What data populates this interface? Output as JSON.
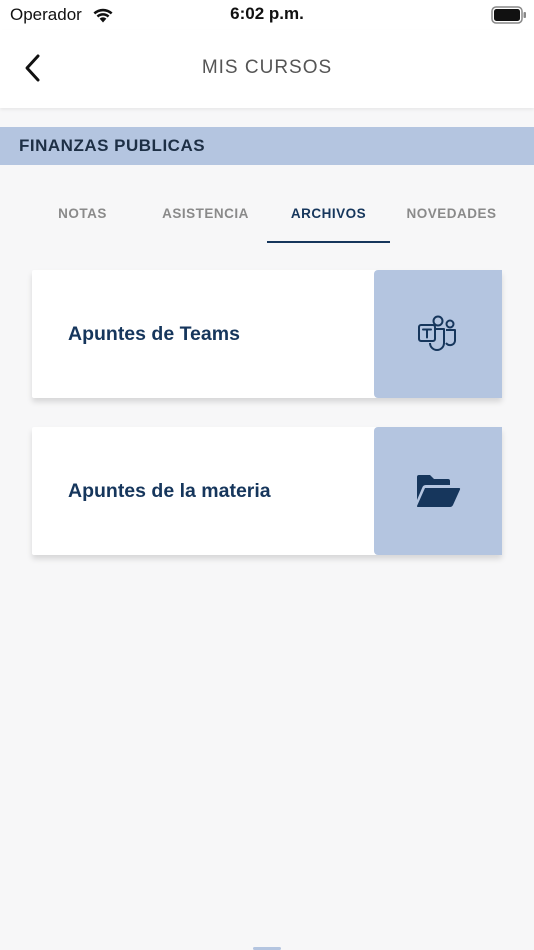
{
  "status_bar": {
    "carrier": "Operador",
    "time": "6:02 p.m."
  },
  "nav": {
    "title": "MIS CURSOS"
  },
  "course": {
    "name": "FINANZAS PUBLICAS"
  },
  "tabs": [
    {
      "label": "NOTAS",
      "active": false
    },
    {
      "label": "ASISTENCIA",
      "active": false
    },
    {
      "label": "ARCHIVOS",
      "active": true
    },
    {
      "label": "NOVEDADES",
      "active": false
    }
  ],
  "cards": [
    {
      "label": "Apuntes de Teams",
      "icon": "teams-icon"
    },
    {
      "label": "Apuntes de la materia",
      "icon": "folder-open-icon"
    }
  ],
  "colors": {
    "accent": "#16365c",
    "header_bg": "#b4c5e0",
    "tab_inactive": "#8a8a8a"
  }
}
